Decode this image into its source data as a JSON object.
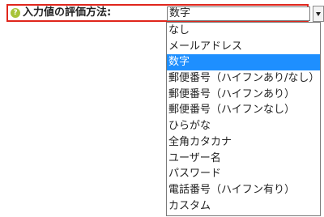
{
  "field": {
    "help_icon_text": "?",
    "label": "入力値の評価方法:"
  },
  "select": {
    "selected_value": "数字",
    "arrow_icon": "chevron-down-icon",
    "options": [
      {
        "label": "なし",
        "selected": false
      },
      {
        "label": "メールアドレス",
        "selected": false
      },
      {
        "label": "数字",
        "selected": true
      },
      {
        "label": "郵便番号（ハイフンあり/なし）",
        "selected": false
      },
      {
        "label": "郵便番号（ハイフンあり）",
        "selected": false
      },
      {
        "label": "郵便番号（ハイフンなし）",
        "selected": false
      },
      {
        "label": "ひらがな",
        "selected": false
      },
      {
        "label": "全角カタカナ",
        "selected": false
      },
      {
        "label": "ユーザー名",
        "selected": false
      },
      {
        "label": "パスワード",
        "selected": false
      },
      {
        "label": "電話番号（ハイフン有り）",
        "selected": false
      },
      {
        "label": "カスタム",
        "selected": false
      }
    ]
  },
  "colors": {
    "highlight_border": "#e0261c",
    "selected_option_bg": "#1e8fff",
    "help_icon_bg": "#a7c43a"
  }
}
